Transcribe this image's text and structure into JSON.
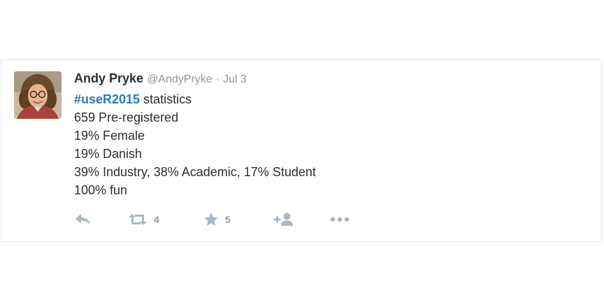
{
  "tweet": {
    "author": {
      "display_name": "Andy Pryke",
      "username": "@AndyPryke"
    },
    "separator": "·",
    "timestamp": "Jul 3",
    "hashtag": "#useR2015",
    "text_after_hashtag": " statistics",
    "lines": [
      "659 Pre-registered",
      "19% Female",
      "19% Danish",
      "39% Industry, 38% Academic, 17% Student",
      "100% fun"
    ]
  },
  "actions": {
    "reply_icon": "reply-icon",
    "retweet_icon": "retweet-icon",
    "retweet_count": "4",
    "favorite_icon": "star-icon",
    "favorite_count": "5",
    "follow_icon": "follow-icon",
    "more_icon": "more-icon"
  },
  "colors": {
    "text": "#292f33",
    "secondary": "#8899a6",
    "hashtag": "#2b7bb9",
    "icon": "#aab8c2",
    "border": "#e1e8ed"
  }
}
